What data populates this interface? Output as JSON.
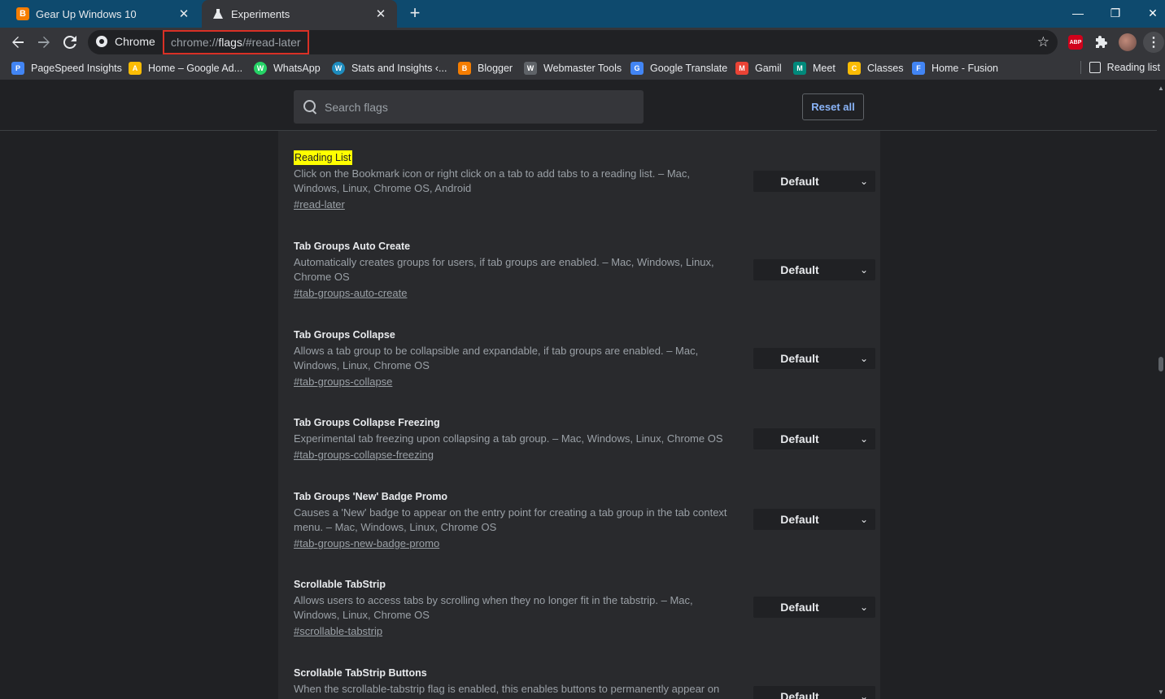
{
  "tabs": [
    {
      "title": "Gear Up Windows 10",
      "icon": "blogger-icon"
    },
    {
      "title": "Experiments",
      "icon": "flask-icon"
    }
  ],
  "toolbar": {
    "site_chip": "Chrome",
    "url_prefix": "chrome://",
    "url_host": "flags",
    "url_suffix": "/#read-later",
    "extensions": {
      "abp": "ABP"
    }
  },
  "bookmarks": [
    {
      "label": "PageSpeed Insights",
      "color": "#4285f4"
    },
    {
      "label": "Home – Google Ad...",
      "color": "#fbbc04"
    },
    {
      "label": "WhatsApp",
      "color": "#25d366"
    },
    {
      "label": "Stats and Insights ‹...",
      "color": "#1e8cbe"
    },
    {
      "label": "Blogger",
      "color": "#f57d00"
    },
    {
      "label": "Webmaster Tools",
      "color": "#5f6368"
    },
    {
      "label": "Google Translate",
      "color": "#4285f4"
    },
    {
      "label": "Gamil",
      "color": "#ea4335"
    },
    {
      "label": "Meet",
      "color": "#00897b"
    },
    {
      "label": "Classes",
      "color": "#fbbc04"
    },
    {
      "label": "Home - Fusion",
      "color": "#4285f4"
    }
  ],
  "reading_list_label": "Reading list",
  "search": {
    "placeholder": "Search flags"
  },
  "reset_label": "Reset all",
  "flags": [
    {
      "title": "Reading List",
      "desc": "Click on the Bookmark icon or right click on a tab to add tabs to a reading list. – Mac, Windows, Linux, Chrome OS, Android",
      "link": "#read-later",
      "value": "Default"
    },
    {
      "title": "Tab Groups Auto Create",
      "desc": "Automatically creates groups for users, if tab groups are enabled. – Mac, Windows, Linux, Chrome OS",
      "link": "#tab-groups-auto-create",
      "value": "Default"
    },
    {
      "title": "Tab Groups Collapse",
      "desc": "Allows a tab group to be collapsible and expandable, if tab groups are enabled. – Mac, Windows, Linux, Chrome OS",
      "link": "#tab-groups-collapse",
      "value": "Default"
    },
    {
      "title": "Tab Groups Collapse Freezing",
      "desc": "Experimental tab freezing upon collapsing a tab group. – Mac, Windows, Linux, Chrome OS",
      "link": "#tab-groups-collapse-freezing",
      "value": "Default"
    },
    {
      "title": "Tab Groups 'New' Badge Promo",
      "desc": "Causes a 'New' badge to appear on the entry point for creating a tab group in the tab context menu. – Mac, Windows, Linux, Chrome OS",
      "link": "#tab-groups-new-badge-promo",
      "value": "Default"
    },
    {
      "title": "Scrollable TabStrip",
      "desc": "Allows users to access tabs by scrolling when they no longer fit in the tabstrip. – Mac, Windows, Linux, Chrome OS",
      "link": "#scrollable-tabstrip",
      "value": "Default"
    },
    {
      "title": "Scrollable TabStrip Buttons",
      "desc": "When the scrollable-tabstrip flag is enabled, this enables buttons to permanently appear on",
      "link": "",
      "value": "Default"
    }
  ]
}
